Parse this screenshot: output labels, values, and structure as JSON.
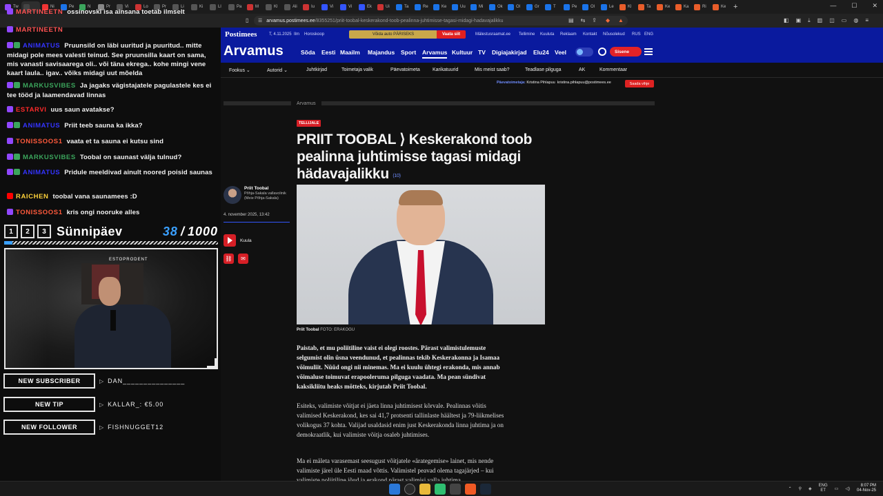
{
  "browser": {
    "tabs": [
      {
        "label": "Tw",
        "color": "#9147ff"
      },
      {
        "label": "",
        "color": "#444",
        "active": true
      },
      {
        "label": "Ni",
        "color": "#e33"
      },
      {
        "label": "Pe",
        "color": "#1a73e8"
      },
      {
        "label": "N",
        "color": "#3ba55c"
      },
      {
        "label": "Pr",
        "color": "#888"
      },
      {
        "label": "Vi",
        "color": "#555"
      },
      {
        "label": "Lo",
        "color": "#c33"
      },
      {
        "label": "Pr",
        "color": "#555"
      },
      {
        "label": "Li",
        "color": "#555"
      },
      {
        "label": "Ki",
        "color": "#555"
      },
      {
        "label": "Ll",
        "color": "#555"
      },
      {
        "label": "Pa",
        "color": "#555"
      },
      {
        "label": "M",
        "color": "#c33"
      },
      {
        "label": "Kl",
        "color": "#555"
      },
      {
        "label": "Ali",
        "color": "#555"
      },
      {
        "label": "Iu",
        "color": "#c33"
      },
      {
        "label": "Vi",
        "color": "#3355ff"
      },
      {
        "label": "Vi",
        "color": "#3355ff"
      },
      {
        "label": "Ek",
        "color": "#3355ff"
      },
      {
        "label": "Ui",
        "color": "#c33"
      },
      {
        "label": "Ta",
        "color": "#1a73e8"
      },
      {
        "label": "Re",
        "color": "#1a73e8"
      },
      {
        "label": "Ke",
        "color": "#1a73e8"
      },
      {
        "label": "Uu",
        "color": "#1a73e8"
      },
      {
        "label": "Mi",
        "color": "#1a73e8"
      },
      {
        "label": "Ok",
        "color": "#1a73e8"
      },
      {
        "label": "Ol",
        "color": "#1a73e8"
      },
      {
        "label": "Gr",
        "color": "#1a73e8"
      },
      {
        "label": "T",
        "color": "#1a73e8"
      },
      {
        "label": "Pe",
        "color": "#1a73e8"
      },
      {
        "label": "Ol",
        "color": "#1a73e8"
      },
      {
        "label": "Le",
        "color": "#1a73e8"
      },
      {
        "label": "Kl",
        "color": "#e85d2a"
      },
      {
        "label": "Ta",
        "color": "#e85d2a"
      },
      {
        "label": "Ke",
        "color": "#e85d2a"
      },
      {
        "label": "Ka",
        "color": "#e85d2a"
      },
      {
        "label": "Ri",
        "color": "#e85d2a"
      },
      {
        "label": "Ke",
        "color": "#e85d2a"
      }
    ],
    "new_tab": "+",
    "url_host": "arvamus.postimees.ee",
    "url_path": "/8355251/priit-toobal-keskerakond-toob-pealinna-juhtimisse-tagasi-midagi-hadavajalikku"
  },
  "chat": [
    {
      "user": "MARTINEETN",
      "color": "#ff5252",
      "badges": [
        "twitch"
      ],
      "text": "ossinovski isa ainsana toetab ilmselt"
    },
    {
      "user": "MARTINEETN",
      "color": "#ff5252",
      "badges": [
        "twitch"
      ],
      "text": ""
    },
    {
      "user": "ANIMATUS",
      "color": "#3434ff",
      "badges": [
        "twitch",
        "verified"
      ],
      "text": "Pruunsild on läbi uuritud ja puuritud.. mitte midagi pole mees valesti teinud. See pruunsilla kaart on sama, mis vanasti savisaarega oli.. või täna ekrega.. kohe mingi vene kaart laula.. igav.. võiks midagi uut mõelda"
    },
    {
      "user": "MARKUSVIBES",
      "color": "#3ba55c",
      "badges": [
        "twitch",
        "verified"
      ],
      "text": "Ja jagaks vägistajatele pagulastele kes ei tee tööd ja laamendavad linnas"
    },
    {
      "user": "ESTARVI",
      "color": "#ff2a2a",
      "badges": [
        "twitch"
      ],
      "text": "uus saun avatakse?"
    },
    {
      "user": "ANIMATUS",
      "color": "#3434ff",
      "badges": [
        "twitch",
        "verified"
      ],
      "text": "Priit teeb sauna ka ikka?"
    },
    {
      "user": "TONISSOOS1",
      "color": "#ff5a3c",
      "badges": [
        "twitch"
      ],
      "text": "vaata et ta sauna ei kutsu sind"
    },
    {
      "user": "MARKUSVIBES",
      "color": "#3ba55c",
      "badges": [
        "twitch",
        "verified"
      ],
      "text": "Toobal on saunast välja tulnud?"
    },
    {
      "user": "ANIMATUS",
      "color": "#3434ff",
      "badges": [
        "twitch",
        "verified"
      ],
      "text": "Pridule meeldivad ainult noored poisid saunas"
    },
    {
      "user": "RAICHEN",
      "color": "#ffd23a",
      "badges": [
        "yt"
      ],
      "text": "toobal vana saunamees :D"
    },
    {
      "user": "TONISSOOS1",
      "color": "#ff5a3c",
      "badges": [
        "twitch"
      ],
      "text": "kris ongi nooruke alles"
    }
  ],
  "goal": {
    "steps": [
      "1",
      "2",
      "3"
    ],
    "title": "Sünnipäev",
    "current": "38",
    "separator": "/",
    "max": "1000",
    "progress": 0.038
  },
  "webcam": {
    "sign": "ESTOPRODENT"
  },
  "alerts": [
    {
      "label": "NEW SUBSCRIBER",
      "value": "DAN_______________"
    },
    {
      "label": "NEW TIP",
      "value": "KALLAR_: €5.00"
    },
    {
      "label": "NEW FOLLOWER",
      "value": "FISHNUGGET12"
    }
  ],
  "site": {
    "brand": "Postimees",
    "date": "T, 4.11.2025",
    "weather": "Ilm",
    "horoscope": "Horoskoop",
    "promo": "Võida auto PÄRISEKS",
    "promo_btn": "Vaata siit",
    "top_links": [
      "Mälestusraamat.ee",
      "Tellimine",
      "Kuuluta",
      "Reklaam",
      "Kontakt",
      "Nõusolekud",
      "RUS",
      "ENG"
    ],
    "section_logo": "Arvamus",
    "nav": [
      "Sõda",
      "Eesti",
      "Maailm",
      "Majandus",
      "Sport",
      "Arvamus",
      "Kultuur",
      "TV",
      "Digiajakirjad",
      "Elu24",
      "Veel"
    ],
    "login": "Sisene",
    "subnav": [
      "Fookus",
      "Autorid",
      "Juhtkirjad",
      "Toimetaja valik",
      "Päevatoimeta",
      "Karikatuurid",
      "Mis meist saab?",
      "Teadlase pilguga",
      "AK",
      "Kommentaar"
    ],
    "editor_label": "Päevatoimetaja:",
    "editor_name": "Kristina Pihlapuu",
    "editor_email": "kristina.pihlapuu@postimees.ee",
    "editor_btn": "Saada vihje",
    "section_label": "Arvamus"
  },
  "article": {
    "tag": "TELLIJALE",
    "headline": "PRIIT TOOBAL ⟩ Keskerakond toob pealinna juhtimisse tagasi midagi hädavajalikku",
    "comments": "(10)",
    "author_name": "Priit Toobal",
    "author_role": "Põhja-Sakala vallavolinik (Meie Põhja-Sakala)",
    "date": "4. november 2025, 13:42",
    "listen": "Kuula",
    "caption_name": "Priit Toobal",
    "caption_credit": "FOTO: ERAKOGU",
    "lead": "Paistab, et mu poliitiline vaist ei olegi roostes. Pärast valimistulemuste selgumist olin üsna veendunud, et pealinnas tekib Keskerakonna ja Isamaa võimuliit. Nüüd ongi nii minemas. Ma ei kuulu ühtegi erakonda, mis annab võimaluse toimuvat erapooleruma pilguga vaadata. Ma pean sündivat kaksikliitu heaks mõtteks, kirjutab Priit Toobal.",
    "para1": "Esiteks, valimiste võitjat ei jäeta linna juhtimisest kõrvale. Pealinnas võitis valimised Keskerakond, kes sai 41,7 protsenti tallinlaste häältest ja 79-liikmelises volikogus 37 kohta. Valijad usaldasid enim just Keskerakonda linna juhtima ja on demokraatlik, kui valimiste võitja osaleb juhtimises.",
    "para2": "Ma ei mäleta varasemast seesugust võitjatele «ärategemise» lainet, mis nende valimiste järel üle Eesti maad võttis. Valimistel peavad olema tagajärjed – kui valimiste poliitiline jõud ja erakond pärast valimisi valla juhtima."
  },
  "taskbar": {
    "lang1": "ENG",
    "lang2": "ET",
    "time": "8:07 PM",
    "date": "04-Nov-25"
  }
}
